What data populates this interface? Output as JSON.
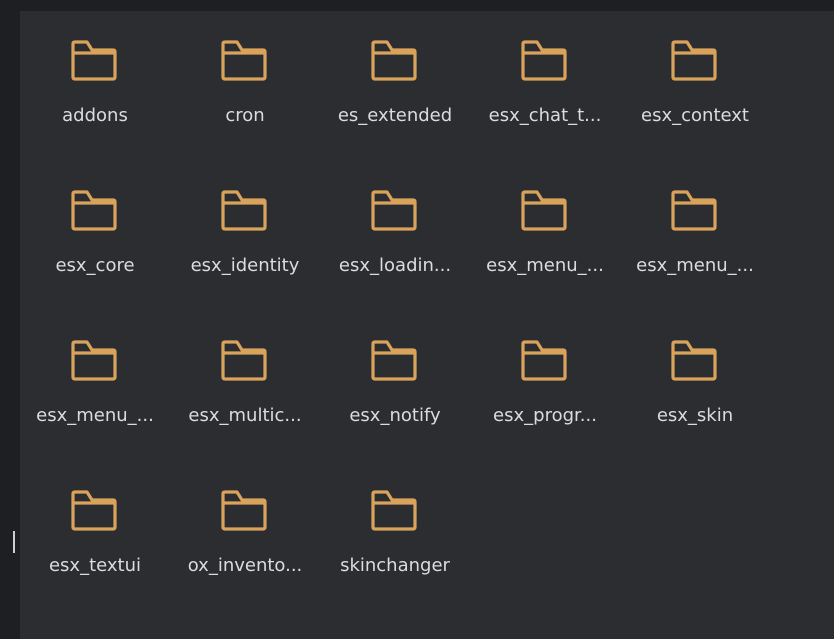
{
  "theme": {
    "folder_color": "#d9a35b",
    "label_color": "#dcdcdc",
    "panel_bg": "#2b2d31",
    "page_bg": "#1e1f22"
  },
  "folders": [
    {
      "label": "addons",
      "icon": "folder-icon"
    },
    {
      "label": "cron",
      "icon": "folder-icon"
    },
    {
      "label": "es_extended",
      "icon": "folder-icon"
    },
    {
      "label": "esx_chat_t...",
      "icon": "folder-icon"
    },
    {
      "label": "esx_context",
      "icon": "folder-icon"
    },
    {
      "label": "esx_core",
      "icon": "folder-icon"
    },
    {
      "label": "esx_identity",
      "icon": "folder-icon"
    },
    {
      "label": "esx_loadin...",
      "icon": "folder-icon"
    },
    {
      "label": "esx_menu_...",
      "icon": "folder-icon"
    },
    {
      "label": "esx_menu_...",
      "icon": "folder-icon"
    },
    {
      "label": "esx_menu_...",
      "icon": "folder-icon"
    },
    {
      "label": "esx_multic...",
      "icon": "folder-icon"
    },
    {
      "label": "esx_notify",
      "icon": "folder-icon"
    },
    {
      "label": "esx_progr...",
      "icon": "folder-icon"
    },
    {
      "label": "esx_skin",
      "icon": "folder-icon"
    },
    {
      "label": "esx_textui",
      "icon": "folder-icon"
    },
    {
      "label": "ox_invento...",
      "icon": "folder-icon"
    },
    {
      "label": "skinchanger",
      "icon": "folder-icon"
    }
  ]
}
